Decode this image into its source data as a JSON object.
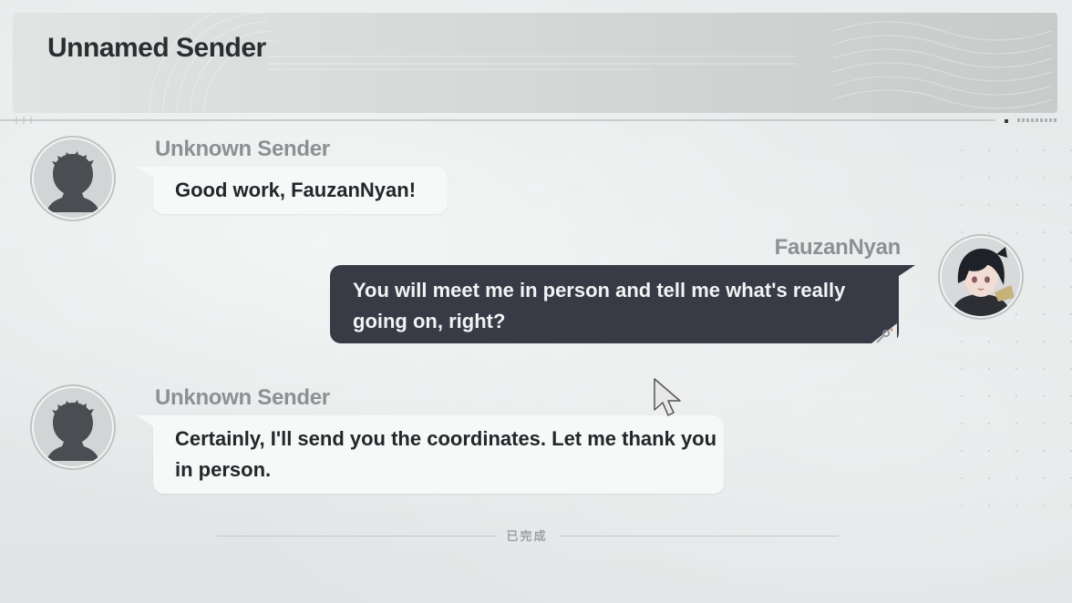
{
  "header": {
    "title": "Unnamed Sender"
  },
  "messages": [
    {
      "sender": "Unknown Sender",
      "side": "left",
      "avatar_icon": "silhouette-avatar-icon",
      "text": "Good work, FauzanNyan!"
    },
    {
      "sender": "FauzanNyan",
      "side": "right",
      "avatar_icon": "player-portrait-icon",
      "text": "You will meet me in person and tell me what's really going on, right?"
    },
    {
      "sender": "Unknown Sender",
      "side": "left",
      "avatar_icon": "silhouette-avatar-icon",
      "text": "Certainly, I'll send you the coordinates. Let me thank you in person."
    }
  ],
  "footer": {
    "label": "已完成"
  },
  "colors": {
    "bubble_out": "#383b45",
    "bubble_in": "#f7f8f8",
    "sender_name": "#8d9093"
  }
}
